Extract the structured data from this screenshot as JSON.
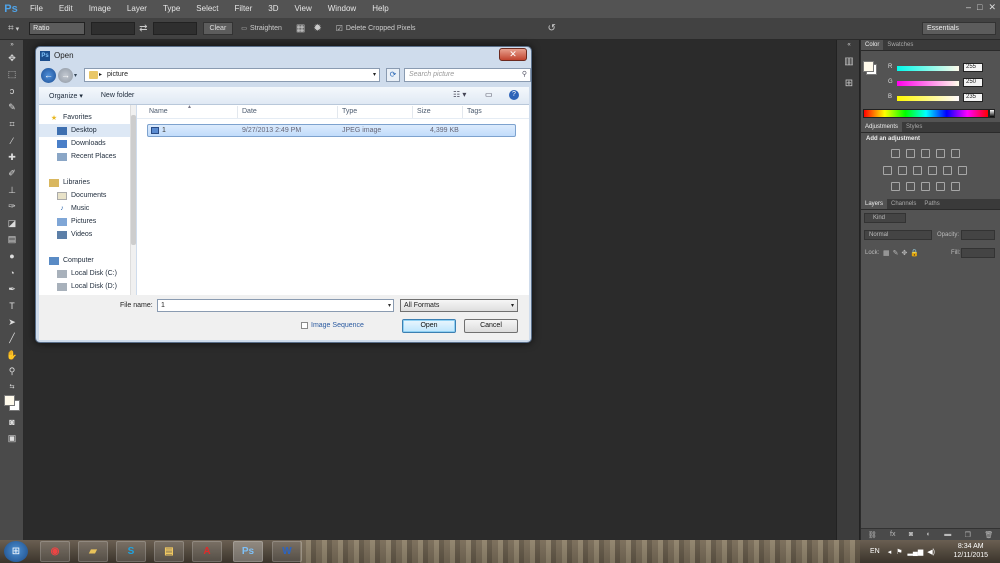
{
  "app": {
    "logo": "Ps"
  },
  "menubar": {
    "items": [
      "File",
      "Edit",
      "Image",
      "Layer",
      "Type",
      "Select",
      "Filter",
      "3D",
      "View",
      "Window",
      "Help"
    ]
  },
  "window_controls": {
    "minimize": "–",
    "maximize": "□",
    "close": "✕"
  },
  "optionsbar": {
    "preset": "Ratio",
    "clear_label": "Clear",
    "straighten_label": "Straighten",
    "delete_cropped_label": "Delete Cropped Pixels",
    "workspace": "Essentials"
  },
  "color_panel": {
    "tabs": [
      "Color",
      "Swatches"
    ],
    "r_label": "R",
    "g_label": "G",
    "b_label": "B",
    "r": "255",
    "g": "250",
    "b": "235"
  },
  "adjust_panel": {
    "tabs": [
      "Adjustments",
      "Styles"
    ],
    "heading": "Add an adjustment"
  },
  "layers_panel": {
    "tabs": [
      "Layers",
      "Channels",
      "Paths"
    ],
    "kind": "Kind",
    "blend": "Normal",
    "opacity_label": "Opacity:",
    "lock_label": "Lock:",
    "fill_label": "Fill:"
  },
  "dialog": {
    "title": "Open",
    "path": "picture",
    "search_placeholder": "Search picture",
    "organize": "Organize ▾",
    "new_folder": "New folder",
    "nav": {
      "favorites": "Favorites",
      "desktop": "Desktop",
      "downloads": "Downloads",
      "recent": "Recent Places",
      "libraries": "Libraries",
      "documents": "Documents",
      "music": "Music",
      "pictures": "Pictures",
      "videos": "Videos",
      "computer": "Computer",
      "local_c": "Local Disk (C:)",
      "local_d": "Local Disk (D:)"
    },
    "columns": {
      "name": "Name",
      "date": "Date",
      "type": "Type",
      "size": "Size",
      "tags": "Tags"
    },
    "file": {
      "name": "1",
      "date": "9/27/2013 2:49 PM",
      "type": "JPEG image",
      "size": "4,399 KB"
    },
    "filename_label": "File name:",
    "filename_value": "1",
    "formats": "All Formats",
    "image_sequence": "Image Sequence",
    "open": "Open",
    "cancel": "Cancel"
  },
  "taskbar": {
    "lang": "EN",
    "time": "8:34 AM",
    "date": "12/11/2015"
  }
}
